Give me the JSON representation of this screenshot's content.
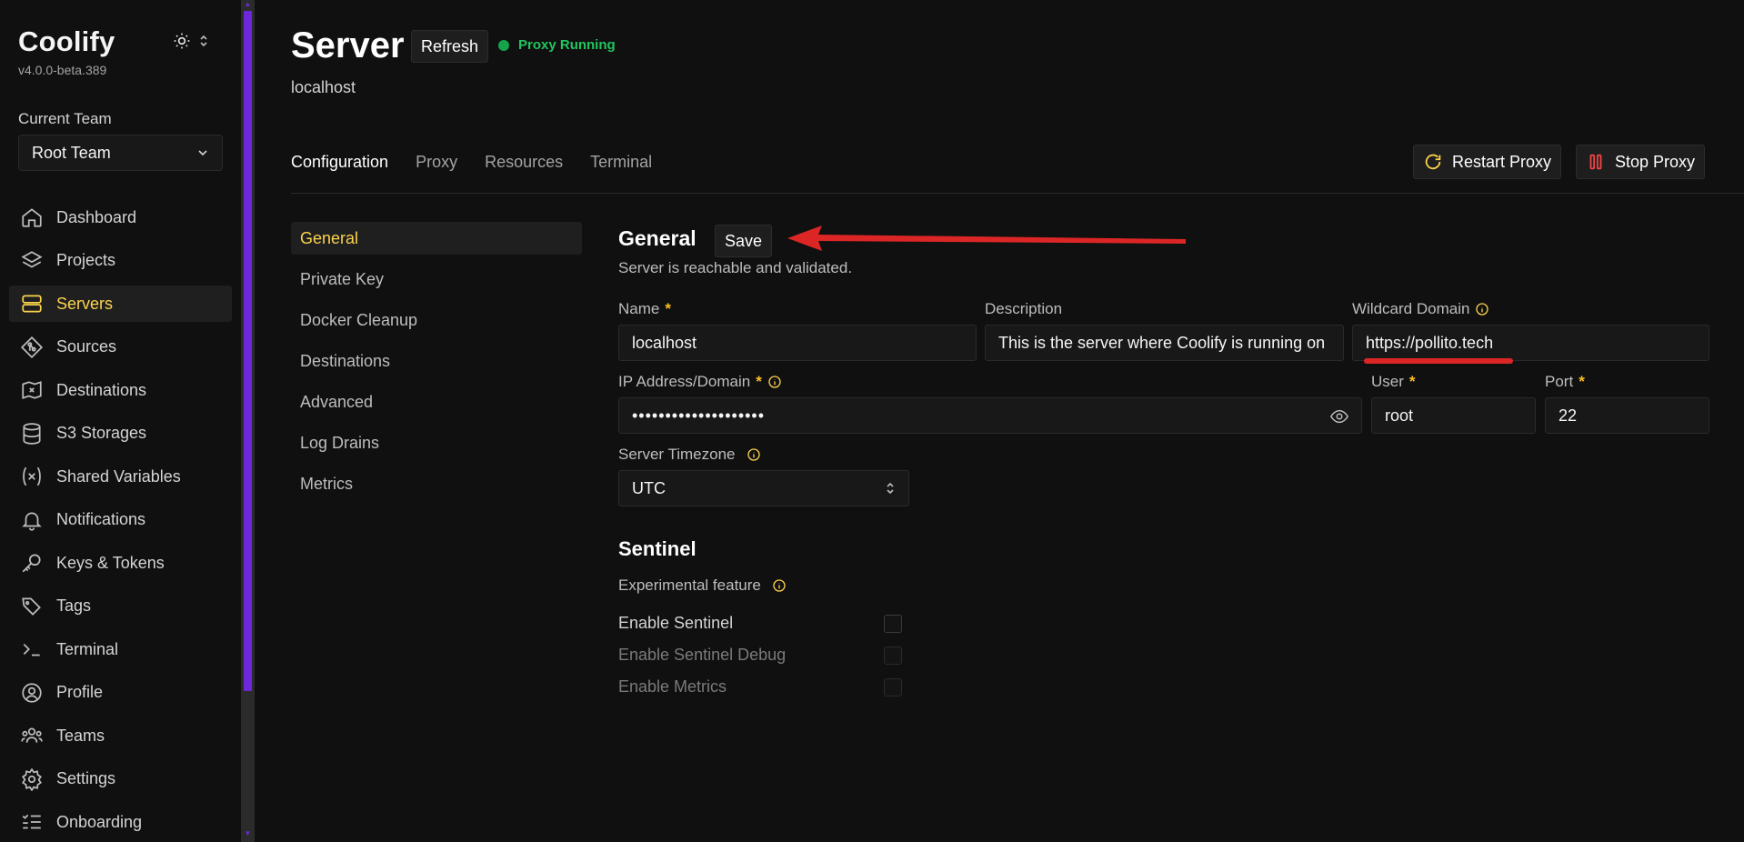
{
  "app": {
    "name": "Coolify",
    "version": "v4.0.0-beta.389"
  },
  "team": {
    "label": "Current Team",
    "selected": "Root Team"
  },
  "sidebar": {
    "items": [
      {
        "label": "Dashboard",
        "icon": "home-icon"
      },
      {
        "label": "Projects",
        "icon": "layers-icon"
      },
      {
        "label": "Servers",
        "icon": "server-icon",
        "active": true
      },
      {
        "label": "Sources",
        "icon": "git-icon"
      },
      {
        "label": "Destinations",
        "icon": "destination-icon"
      },
      {
        "label": "S3 Storages",
        "icon": "database-icon"
      },
      {
        "label": "Shared Variables",
        "icon": "variables-icon"
      },
      {
        "label": "Notifications",
        "icon": "bell-icon"
      },
      {
        "label": "Keys & Tokens",
        "icon": "key-icon"
      },
      {
        "label": "Tags",
        "icon": "tags-icon"
      },
      {
        "label": "Terminal",
        "icon": "terminal-icon"
      },
      {
        "label": "Profile",
        "icon": "user-icon"
      },
      {
        "label": "Teams",
        "icon": "users-icon"
      },
      {
        "label": "Settings",
        "icon": "gear-icon"
      },
      {
        "label": "Onboarding",
        "icon": "list-icon"
      }
    ]
  },
  "header": {
    "title": "Server",
    "refresh_label": "Refresh",
    "status": "Proxy Running",
    "status_color": "#22c55e",
    "subtitle": "localhost"
  },
  "tabs": [
    {
      "label": "Configuration",
      "active": true
    },
    {
      "label": "Proxy"
    },
    {
      "label": "Resources"
    },
    {
      "label": "Terminal"
    }
  ],
  "actions": {
    "restart_proxy": "Restart Proxy",
    "stop_proxy": "Stop Proxy"
  },
  "subnav": [
    {
      "label": "General",
      "active": true
    },
    {
      "label": "Private Key"
    },
    {
      "label": "Docker Cleanup"
    },
    {
      "label": "Destinations"
    },
    {
      "label": "Advanced"
    },
    {
      "label": "Log Drains"
    },
    {
      "label": "Metrics"
    }
  ],
  "general": {
    "title": "General",
    "save_label": "Save",
    "status_text": "Server is reachable and validated.",
    "name": {
      "label": "Name",
      "required": "*",
      "value": "localhost"
    },
    "description": {
      "label": "Description",
      "value": "This is the server where Coolify is running on"
    },
    "wildcard": {
      "label": "Wildcard Domain",
      "value": "https://pollito.tech"
    },
    "ip": {
      "label": "IP Address/Domain",
      "required": "*",
      "value": "••••••••••••••••••••"
    },
    "user": {
      "label": "User",
      "required": "*",
      "value": "root"
    },
    "port": {
      "label": "Port",
      "required": "*",
      "value": "22"
    },
    "timezone": {
      "label": "Server Timezone",
      "value": "UTC"
    }
  },
  "sentinel": {
    "title": "Sentinel",
    "experimental": "Experimental feature",
    "enable": "Enable Sentinel",
    "enable_debug": "Enable Sentinel Debug",
    "enable_metrics": "Enable Metrics"
  },
  "colors": {
    "accent": "#fcd34d",
    "scroll_thumb": "#6d28d9",
    "annotation": "#dc2626"
  }
}
